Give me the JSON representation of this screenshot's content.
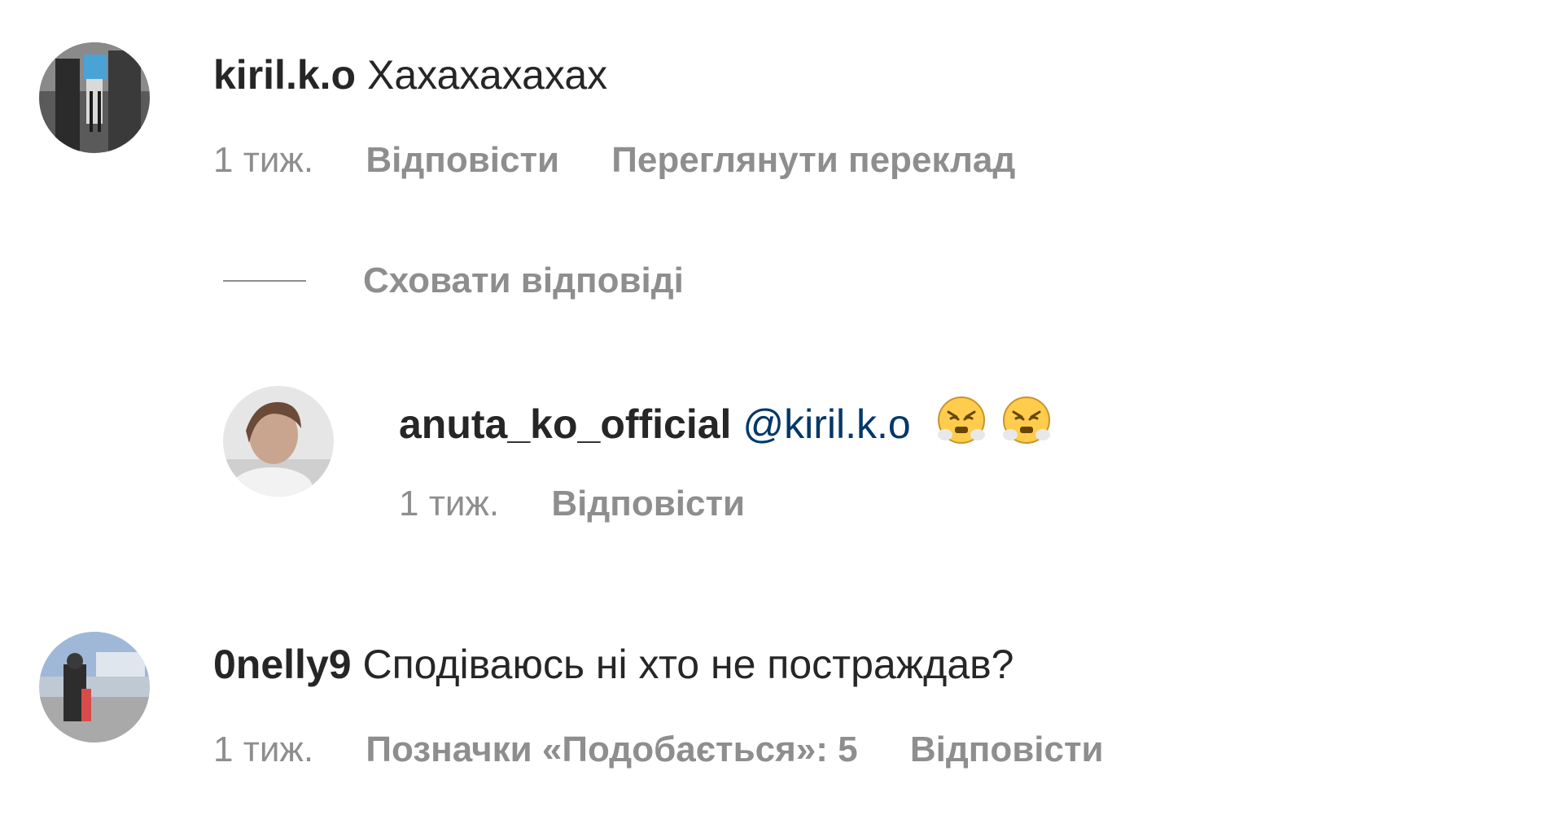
{
  "comments": [
    {
      "username": "kiril.k.o",
      "text": "Хахахахахах",
      "time": "1 тиж.",
      "actions": [
        "Відповісти",
        "Переглянути переклад"
      ]
    },
    {
      "username": "anuta_ko_official",
      "mention": "@kiril.k.o",
      "emojis": [
        "face-with-steam-from-nose",
        "face-with-steam-from-nose"
      ],
      "time": "1 тиж.",
      "actions": [
        "Відповісти"
      ]
    },
    {
      "username": "0nelly9",
      "text": "Сподіваюсь ні хто не постраждав?",
      "time": "1 тиж.",
      "actions": [
        "Позначки «Подобається»: 5",
        "Відповісти"
      ]
    }
  ],
  "hide_replies_label": "Сховати відповіді",
  "colors": {
    "text_primary": "#262626",
    "text_secondary": "#8e8e8e",
    "mention": "#00376b",
    "emoji_face": "#ffcc4d"
  }
}
